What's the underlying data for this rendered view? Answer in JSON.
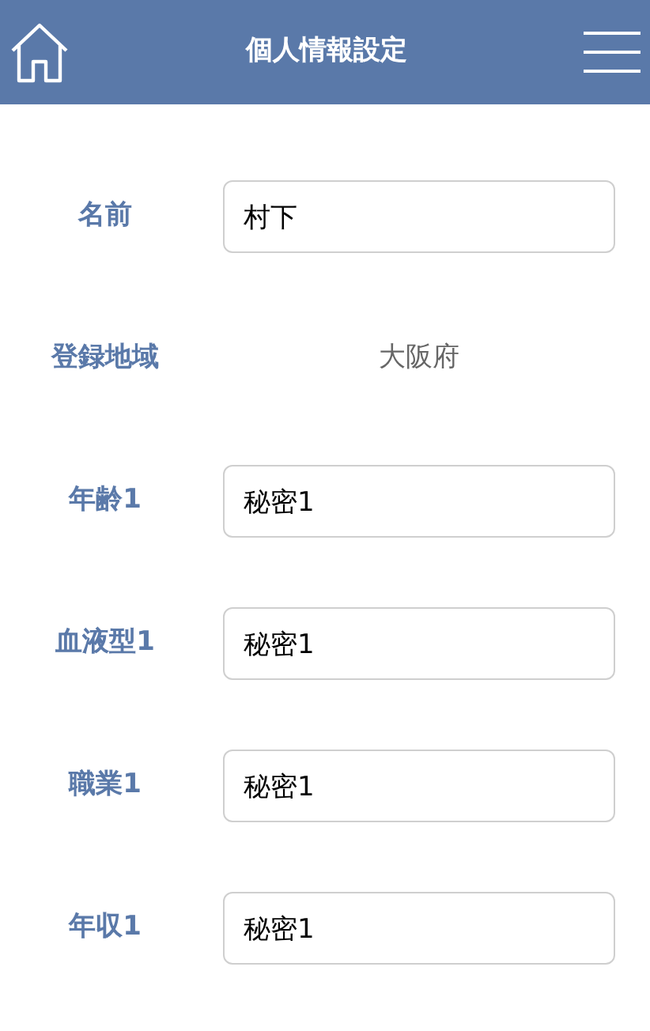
{
  "header": {
    "title": "個人情報設定"
  },
  "fields": [
    {
      "label": "名前",
      "kind": "input",
      "value": "村下"
    },
    {
      "label": "登録地域",
      "kind": "text",
      "value": "大阪府"
    },
    {
      "label": "年齢1",
      "kind": "input",
      "value": "秘密1"
    },
    {
      "label": "血液型1",
      "kind": "input",
      "value": "秘密1"
    },
    {
      "label": "職業1",
      "kind": "input",
      "value": "秘密1"
    },
    {
      "label": "年収1",
      "kind": "input",
      "value": "秘密1"
    }
  ]
}
